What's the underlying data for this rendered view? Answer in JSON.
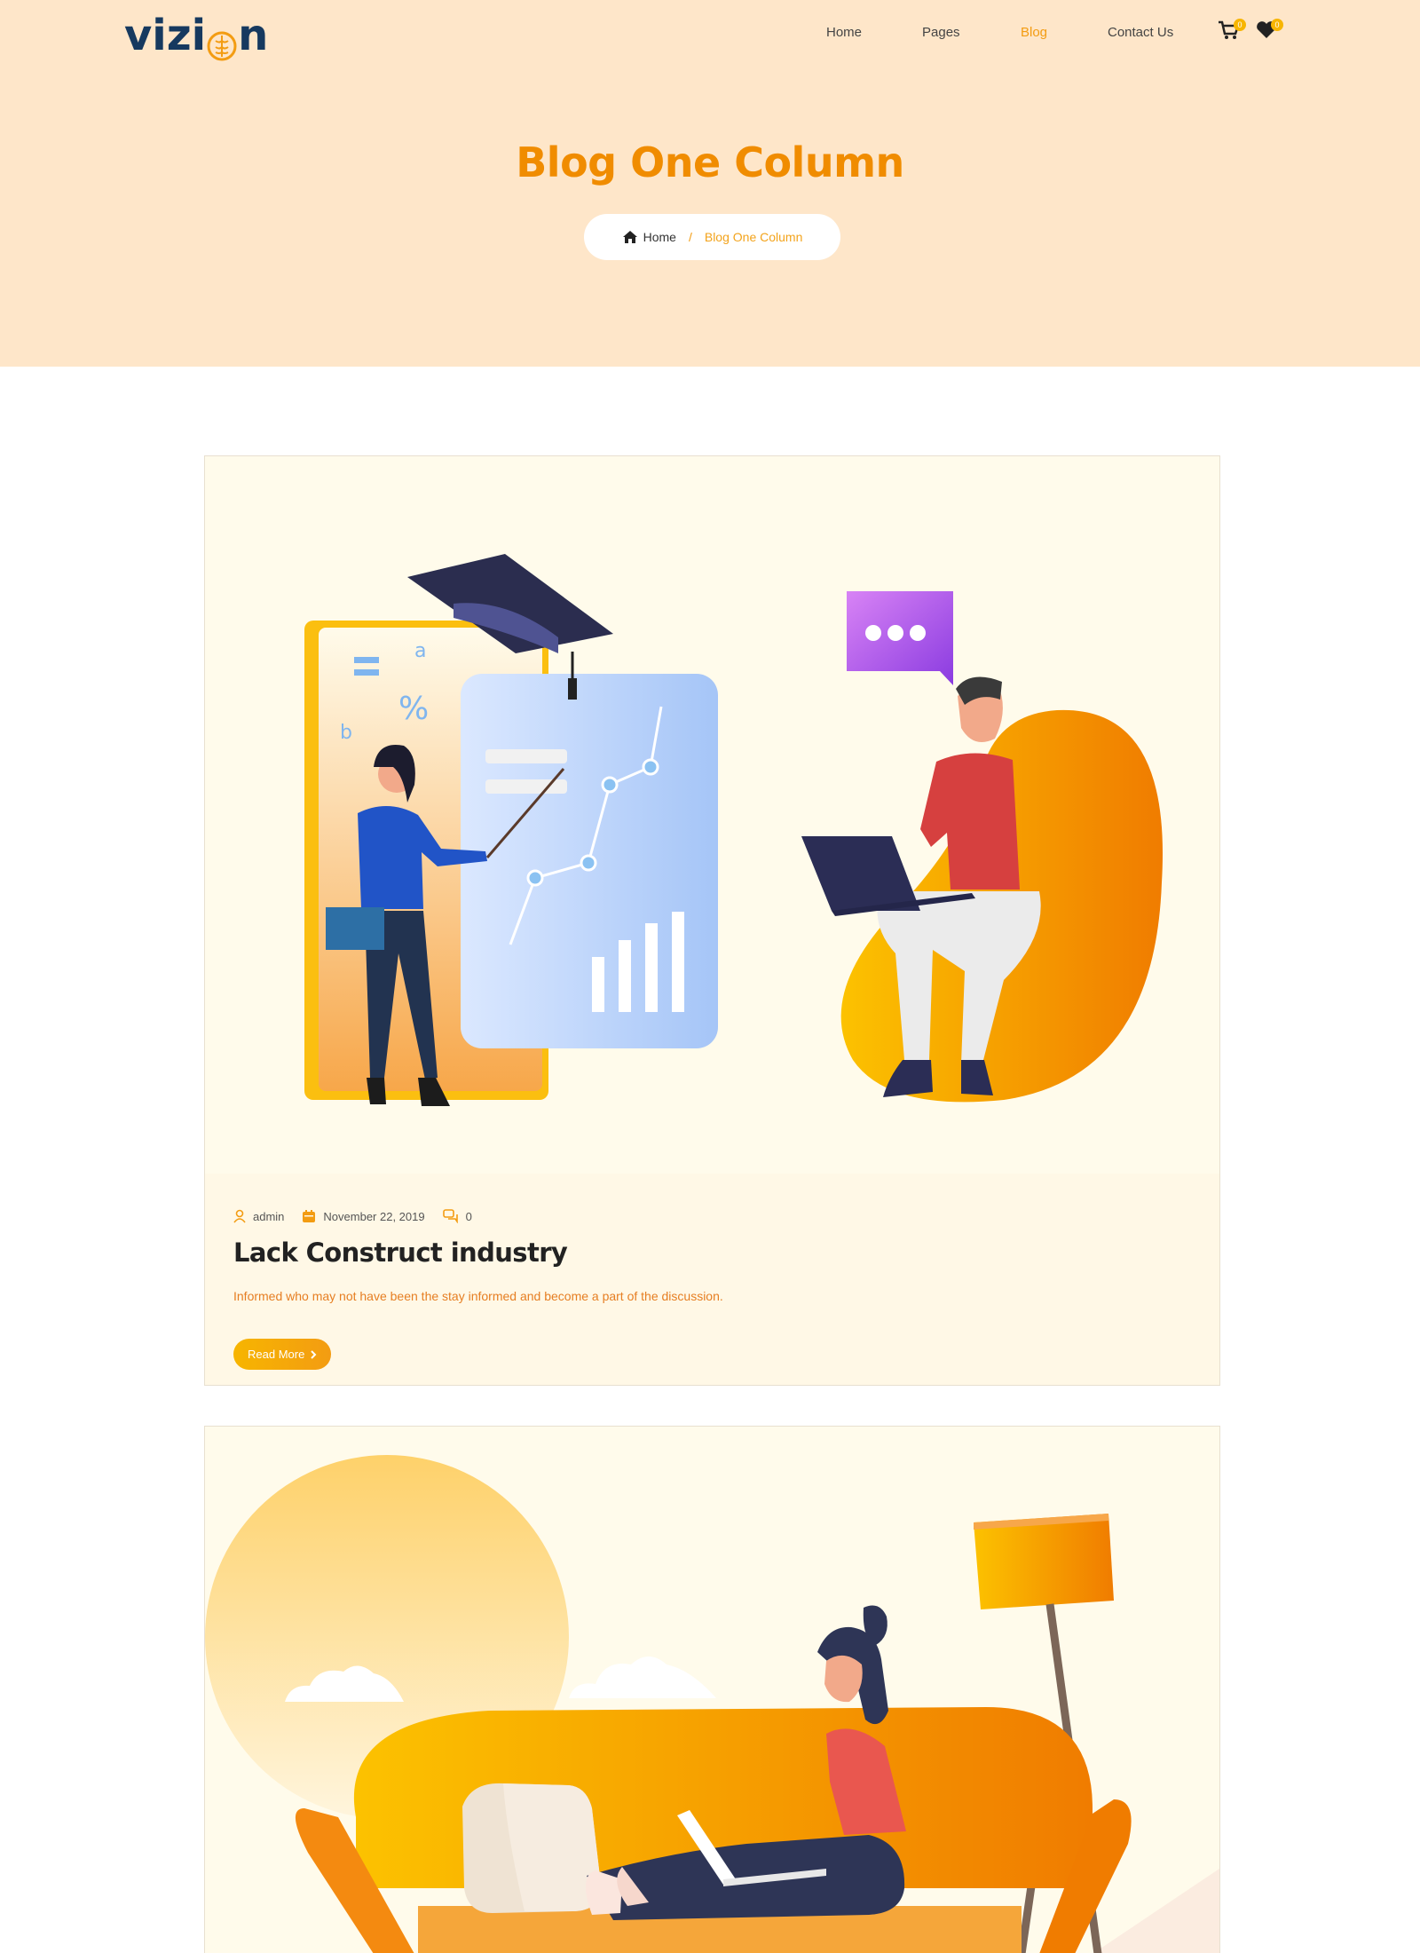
{
  "header": {
    "logo_text_left": "vizi",
    "logo_text_right": "n",
    "nav": [
      {
        "label": "Home",
        "active": false
      },
      {
        "label": "Pages",
        "active": false
      },
      {
        "label": "Blog",
        "active": true
      },
      {
        "label": "Contact Us",
        "active": false
      }
    ],
    "cart_count": "0",
    "wishlist_count": "0"
  },
  "hero": {
    "title": "Blog One Column",
    "breadcrumb": {
      "home": "Home",
      "separator": "/",
      "current": "Blog One Column"
    }
  },
  "posts": [
    {
      "author": "admin",
      "date": "November 22, 2019",
      "comments": "0",
      "title": "Lack Construct industry",
      "excerpt": "Informed who may not have been the stay informed and become a part of the discussion.",
      "read_more": "Read More"
    }
  ],
  "colors": {
    "accent": "#f39c12",
    "hero_bg": "#fee6c9",
    "logo": "#16395f",
    "card_bg": "#fffbeb"
  },
  "icons": [
    "cart-icon",
    "heart-icon",
    "home-icon",
    "user-icon",
    "calendar-icon",
    "comments-icon",
    "chevron-right-icon"
  ]
}
